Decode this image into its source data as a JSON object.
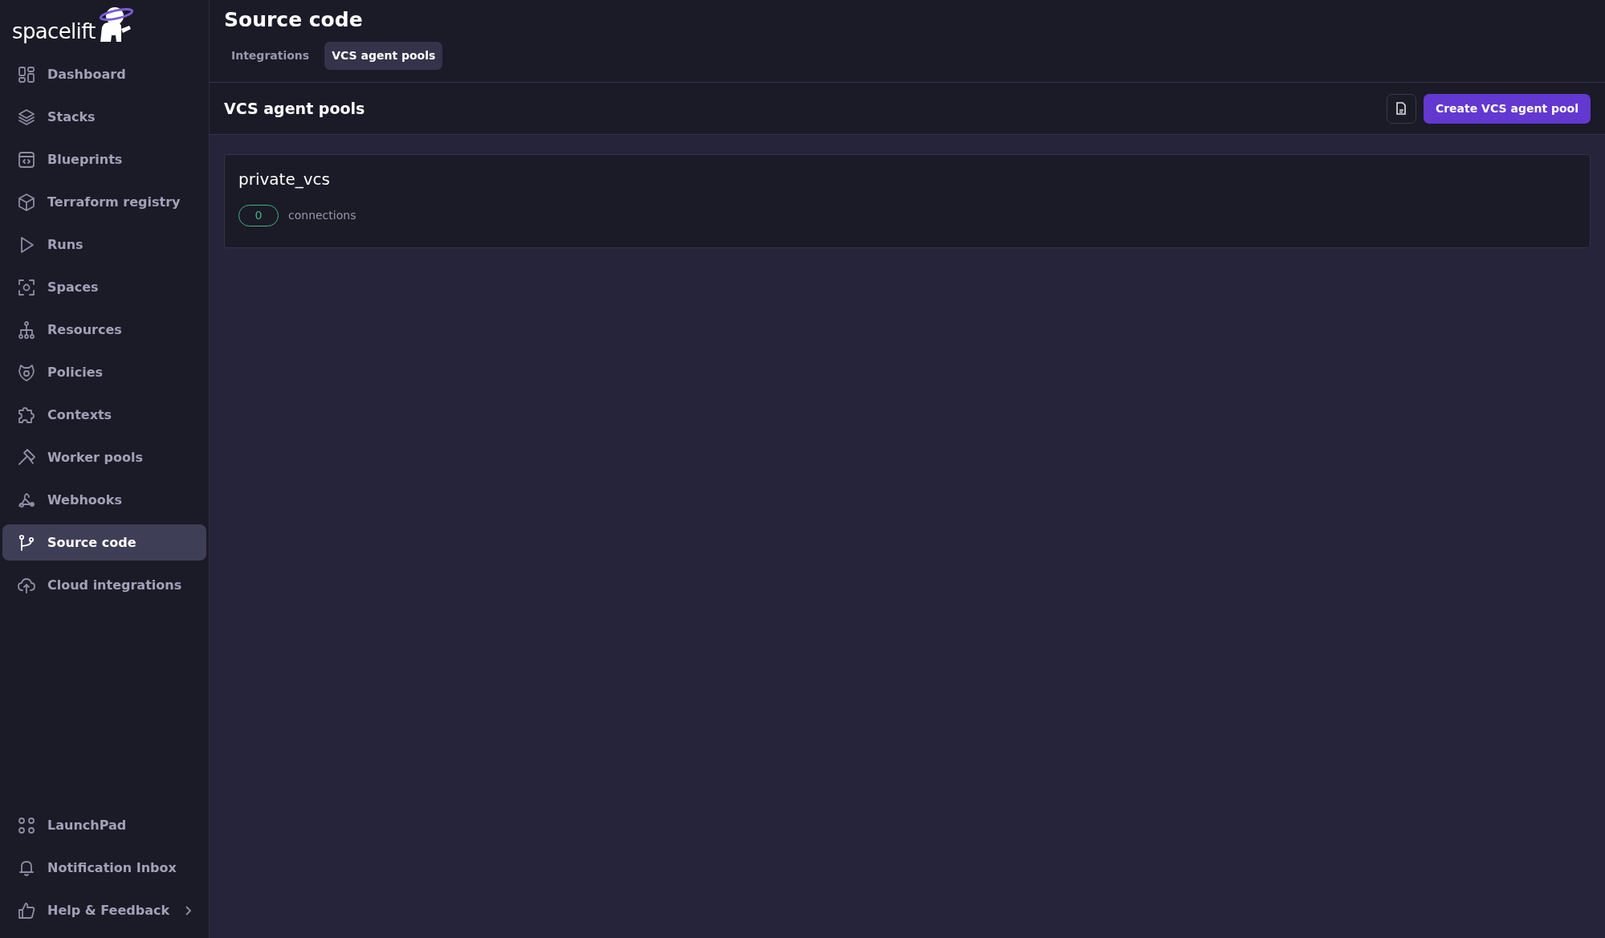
{
  "sidebar": {
    "logo": "spacelift",
    "items": [
      {
        "label": "Dashboard",
        "selected": false
      },
      {
        "label": "Stacks",
        "selected": false
      },
      {
        "label": "Blueprints",
        "selected": false
      },
      {
        "label": "Terraform registry",
        "selected": false
      },
      {
        "label": "Runs",
        "selected": false
      },
      {
        "label": "Spaces",
        "selected": false
      },
      {
        "label": "Resources",
        "selected": false
      },
      {
        "label": "Policies",
        "selected": false
      },
      {
        "label": "Contexts",
        "selected": false
      },
      {
        "label": "Worker pools",
        "selected": false
      },
      {
        "label": "Webhooks",
        "selected": false
      },
      {
        "label": "Source code",
        "selected": true
      },
      {
        "label": "Cloud integrations",
        "selected": false
      }
    ],
    "bottom_items": [
      {
        "label": "LaunchPad"
      },
      {
        "label": "Notification Inbox"
      },
      {
        "label": "Help & Feedback",
        "expandable": true
      }
    ]
  },
  "page": {
    "title": "Source code",
    "tabs": [
      {
        "label": "Integrations",
        "selected": false
      },
      {
        "label": "VCS agent pools",
        "selected": true
      }
    ]
  },
  "section": {
    "title": "VCS agent pools",
    "create_button": "Create VCS agent pool"
  },
  "pools": [
    {
      "name": "private_vcs",
      "connections": "0",
      "connections_label": "connections"
    }
  ]
}
